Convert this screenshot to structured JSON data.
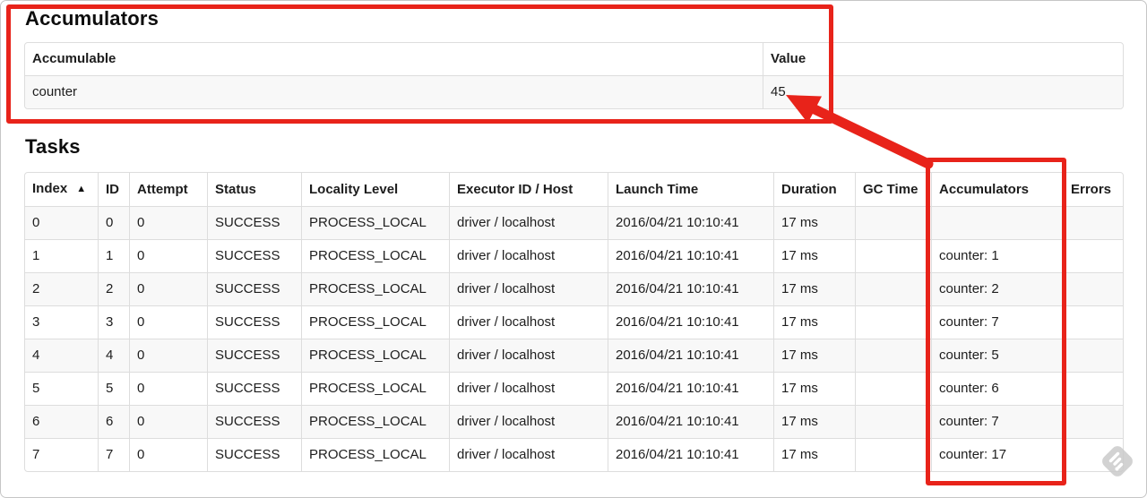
{
  "accumulators_section": {
    "title": "Accumulators",
    "table": {
      "headers": [
        "Accumulable",
        "Value"
      ],
      "rows": [
        [
          "counter",
          "45"
        ]
      ]
    }
  },
  "tasks_section": {
    "title": "Tasks",
    "table": {
      "headers": [
        "Index",
        "ID",
        "Attempt",
        "Status",
        "Locality Level",
        "Executor ID / Host",
        "Launch Time",
        "Duration",
        "GC Time",
        "Accumulators",
        "Errors"
      ],
      "sort": {
        "column": "Index",
        "direction": "asc",
        "icon": "▲"
      },
      "rows": [
        [
          "0",
          "0",
          "0",
          "SUCCESS",
          "PROCESS_LOCAL",
          "driver / localhost",
          "2016/04/21 10:10:41",
          "17 ms",
          "",
          "",
          ""
        ],
        [
          "1",
          "1",
          "0",
          "SUCCESS",
          "PROCESS_LOCAL",
          "driver / localhost",
          "2016/04/21 10:10:41",
          "17 ms",
          "",
          "counter: 1",
          ""
        ],
        [
          "2",
          "2",
          "0",
          "SUCCESS",
          "PROCESS_LOCAL",
          "driver / localhost",
          "2016/04/21 10:10:41",
          "17 ms",
          "",
          "counter: 2",
          ""
        ],
        [
          "3",
          "3",
          "0",
          "SUCCESS",
          "PROCESS_LOCAL",
          "driver / localhost",
          "2016/04/21 10:10:41",
          "17 ms",
          "",
          "counter: 7",
          ""
        ],
        [
          "4",
          "4",
          "0",
          "SUCCESS",
          "PROCESS_LOCAL",
          "driver / localhost",
          "2016/04/21 10:10:41",
          "17 ms",
          "",
          "counter: 5",
          ""
        ],
        [
          "5",
          "5",
          "0",
          "SUCCESS",
          "PROCESS_LOCAL",
          "driver / localhost",
          "2016/04/21 10:10:41",
          "17 ms",
          "",
          "counter: 6",
          ""
        ],
        [
          "6",
          "6",
          "0",
          "SUCCESS",
          "PROCESS_LOCAL",
          "driver / localhost",
          "2016/04/21 10:10:41",
          "17 ms",
          "",
          "counter: 7",
          ""
        ],
        [
          "7",
          "7",
          "0",
          "SUCCESS",
          "PROCESS_LOCAL",
          "driver / localhost",
          "2016/04/21 10:10:41",
          "17 ms",
          "",
          "counter: 17",
          ""
        ]
      ]
    }
  },
  "annotations": {
    "highlight_color": "#e8231a",
    "boxes": [
      "accumulators-section",
      "accumulators-column"
    ],
    "arrow_points_to": "45"
  },
  "watermark": {
    "icon": "feedly-logo"
  }
}
